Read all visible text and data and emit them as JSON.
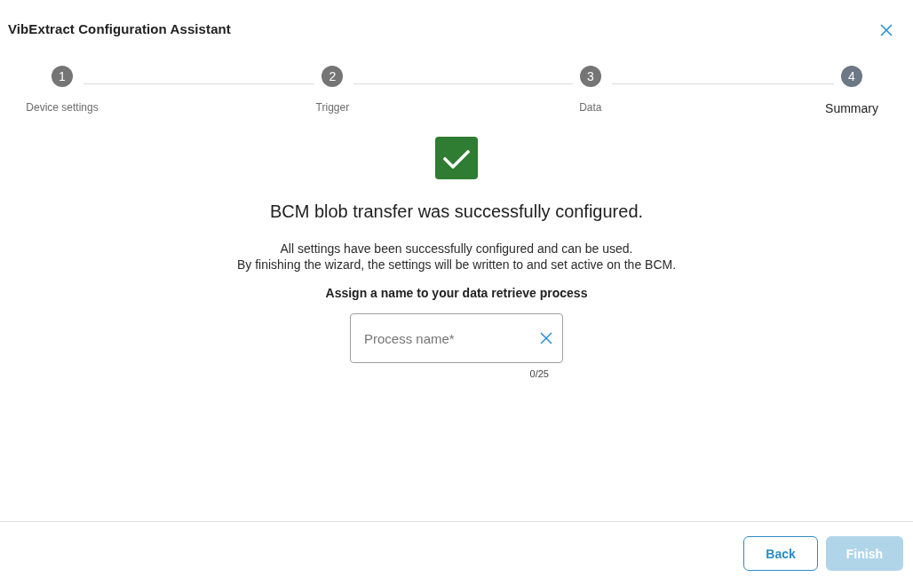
{
  "dialog": {
    "title": "VibExtract Configuration Assistant"
  },
  "stepper": {
    "steps": [
      {
        "number": "1",
        "label": "Device settings",
        "selected": false
      },
      {
        "number": "2",
        "label": "Trigger",
        "selected": false
      },
      {
        "number": "3",
        "label": "Data",
        "selected": false
      },
      {
        "number": "4",
        "label": "Summary",
        "selected": true
      }
    ]
  },
  "summary": {
    "heading": "BCM blob transfer was successfully configured.",
    "description": [
      "All settings have been successfully configured and can be used.",
      "By finishing the wizard, the settings will be written to and set active on the BCM."
    ],
    "prompt": "Assign a name to your data retrieve process",
    "field": {
      "placeholder": "Process name*",
      "counter": "0/25"
    }
  },
  "footer": {
    "buttons": [
      {
        "label": "Back",
        "kind": "outlined",
        "disabled": false
      },
      {
        "label": "Finish",
        "kind": "primary",
        "disabled": true
      }
    ]
  }
}
